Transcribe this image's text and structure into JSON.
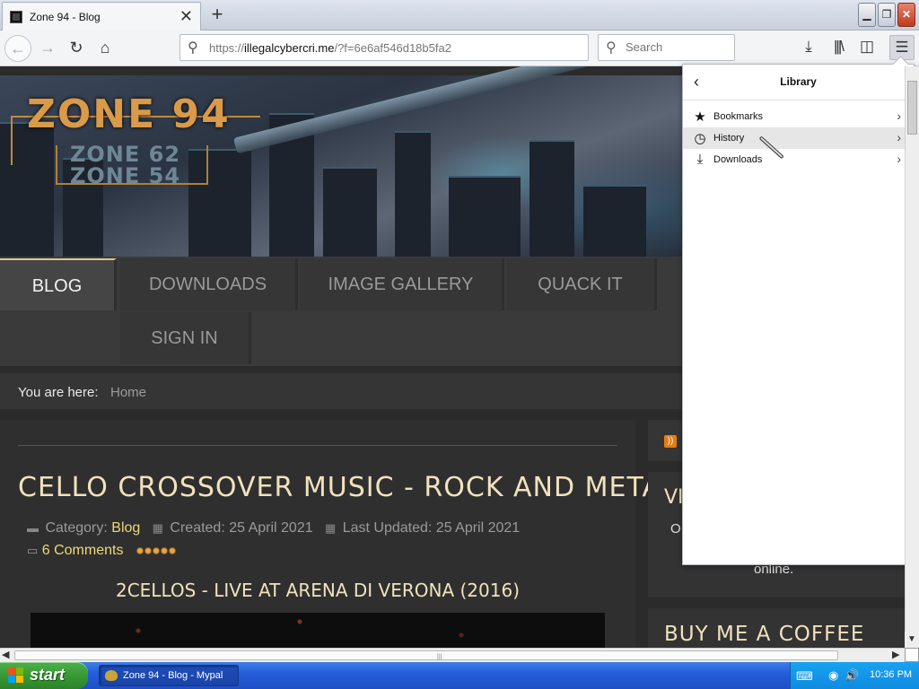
{
  "browser": {
    "tab_title": "Zone 94 - Blog",
    "tab_close": "✕",
    "new_tab": "+",
    "window_buttons": {
      "minimize": "▁",
      "maximize": "❐",
      "close": "✕"
    },
    "nav": {
      "back": "←",
      "forward": "→",
      "reload": "↻",
      "home": "⌂"
    },
    "url_prefix": "https://",
    "url_domain": "illegalcybercri.me",
    "url_path": "/?f=6e6af546d18b5fa2",
    "search_placeholder": "Search",
    "toolbar_icons": {
      "downloads": "⤓",
      "library": "|||\\",
      "sidebar": "◫",
      "menu": "☰"
    },
    "search_icon": "⚲"
  },
  "site": {
    "logo_main": "ZONE 94",
    "logo_sub1": "ZONE 62",
    "logo_sub2": "ZONE 54",
    "nav": {
      "blog": "BLOG",
      "downloads": "DOWNLOADS",
      "gallery": "IMAGE GALLERY",
      "quack": "QUACK IT",
      "signin": "SIGN IN"
    },
    "breadcrumb": {
      "label": "You are here:",
      "current": "Home"
    },
    "article": {
      "title": "CELLO CROSSOVER MUSIC - ROCK AND METAL",
      "category_label": "Category:",
      "category": "Blog",
      "created": "Created: 25 April 2021",
      "updated": "Last Updated: 25 April 2021",
      "comments": "6 Comments",
      "video_title": "2CELLOS - LIVE AT ARENA DI VERONA (2016)"
    },
    "sidebar": {
      "visitors_heading": "VI",
      "visitors_text1": "O",
      "visitors_text2": "online.",
      "coffee_heading": "BUY ME A COFFEE"
    }
  },
  "library_panel": {
    "back": "‹",
    "title": "Library",
    "items": [
      {
        "label": "Bookmarks",
        "icon": "★",
        "arrow": "›"
      },
      {
        "label": "History",
        "icon": "◷",
        "arrow": "›"
      },
      {
        "label": "Downloads",
        "icon": "⤓",
        "arrow": "›"
      }
    ]
  },
  "scroll": {
    "left": "◀",
    "right": "▶",
    "down": "▼",
    "grip": "|||"
  },
  "taskbar": {
    "start_label": "start",
    "task_label": "Zone 94 - Blog - Mypal",
    "clock": "10:36 PM",
    "tray_kbd": "⌨",
    "tray_net": "◉",
    "tray_vol": "🔊"
  },
  "colors": {
    "accent_gold": "#f0d77b",
    "title_cream": "#f1e2bd",
    "start_green": "#379a34",
    "taskbar_blue": "#245edb"
  }
}
